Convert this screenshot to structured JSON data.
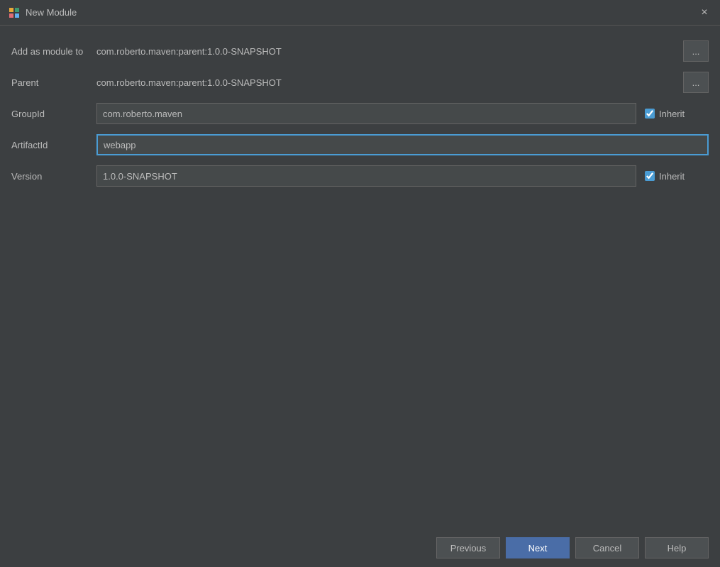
{
  "window": {
    "title": "New Module",
    "close_label": "×"
  },
  "form": {
    "add_module_label": "Add as module to",
    "add_module_value": "com.roberto.maven:parent:1.0.0-SNAPSHOT",
    "parent_label": "Parent",
    "parent_value": "com.roberto.maven:parent:1.0.0-SNAPSHOT",
    "group_id_label": "GroupId",
    "group_id_value": "com.roberto.maven",
    "group_id_inherit_checked": true,
    "artifact_id_label": "ArtifactId",
    "artifact_id_value": "webapp",
    "version_label": "Version",
    "version_value": "1.0.0-SNAPSHOT",
    "version_inherit_checked": true,
    "inherit_label": "Inherit",
    "browse_label": "..."
  },
  "footer": {
    "previous_label": "Previous",
    "next_label": "Next",
    "cancel_label": "Cancel",
    "help_label": "Help"
  }
}
